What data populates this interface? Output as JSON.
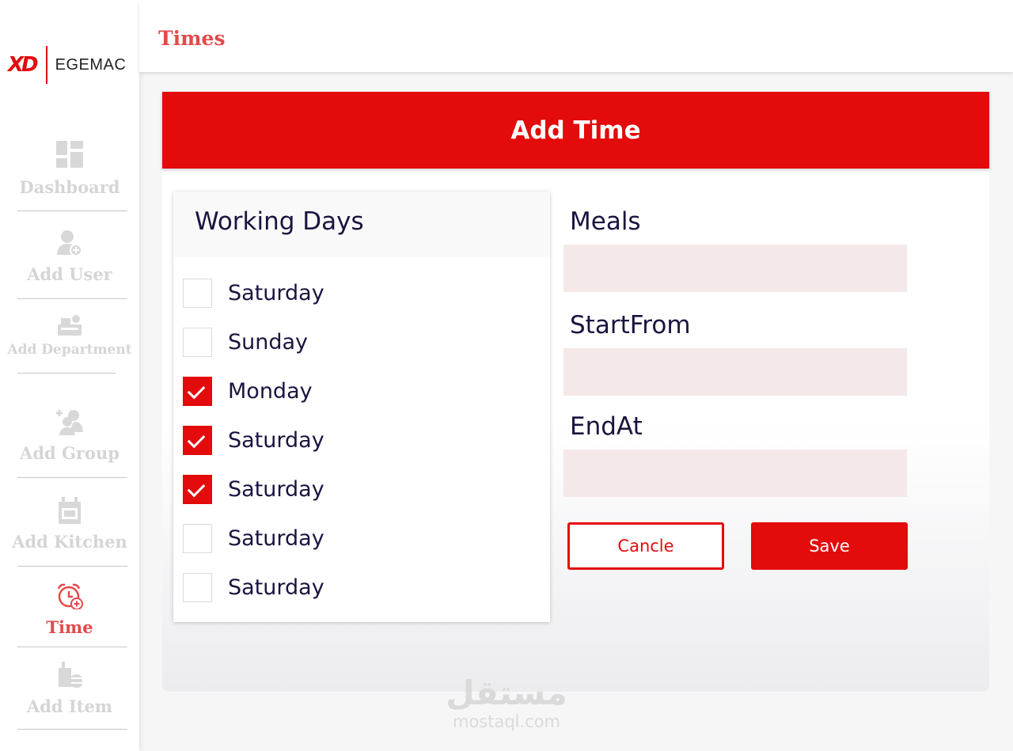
{
  "brand": {
    "mark": "XD",
    "name": "EGEMAC"
  },
  "sidebar": {
    "items": [
      {
        "label": "Dashboard",
        "icon": "dashboard-icon"
      },
      {
        "label": "Add User",
        "icon": "add-user-icon"
      },
      {
        "label": "Add Department",
        "icon": "department-icon"
      },
      {
        "label": "Add Group",
        "icon": "add-group-icon"
      },
      {
        "label": "Add Kitchen",
        "icon": "kitchen-icon"
      },
      {
        "label": "Time",
        "icon": "alarm-clock-icon",
        "active": true
      },
      {
        "label": "Add Item",
        "icon": "food-item-icon"
      }
    ]
  },
  "header": {
    "title": "Times"
  },
  "panel": {
    "title": "Add Time"
  },
  "working_days": {
    "title": "Working Days",
    "days": [
      {
        "label": "Saturday",
        "checked": false
      },
      {
        "label": "Sunday",
        "checked": false
      },
      {
        "label": "Monday",
        "checked": true
      },
      {
        "label": "Saturday",
        "checked": true
      },
      {
        "label": "Saturday",
        "checked": true
      },
      {
        "label": "Saturday",
        "checked": false
      },
      {
        "label": "Saturday",
        "checked": false
      }
    ]
  },
  "form": {
    "meals_label": "Meals",
    "meals_value": "",
    "start_label": "StartFrom",
    "start_value": "",
    "end_label": "EndAt",
    "end_value": "",
    "cancel_label": "Cancle",
    "save_label": "Save"
  },
  "watermark": {
    "arabic": "مستقل",
    "latin": "mostaql.com"
  },
  "colors": {
    "accent": "#e30b0b",
    "active_nav": "#e34a4a",
    "text": "#1a1440",
    "input_bg": "#f5e8e8"
  }
}
